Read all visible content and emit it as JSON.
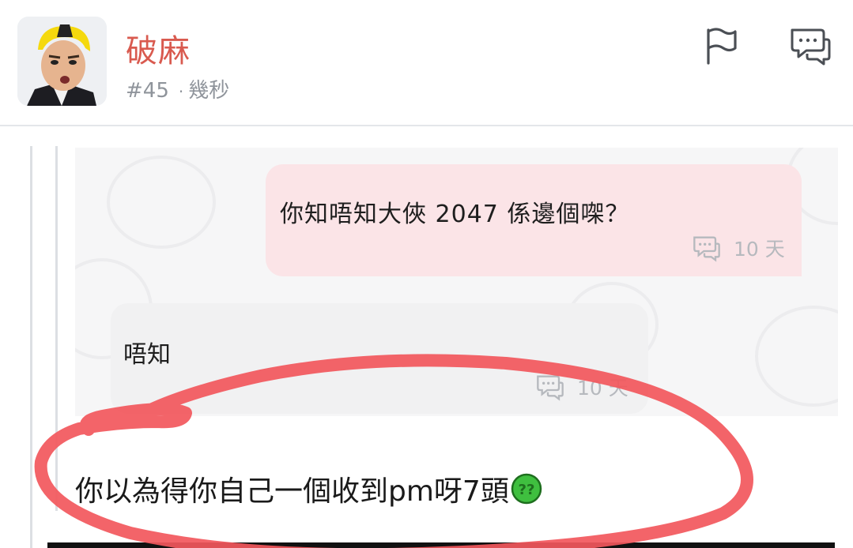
{
  "post": {
    "username": "破麻",
    "number": "#45",
    "separator": "·",
    "time": "幾秒",
    "avatar_icon": "cartoon-face-avatar"
  },
  "actions": {
    "report_icon": "flag-icon",
    "reply_icon": "chat-bubble-icon"
  },
  "chat": {
    "outgoing": {
      "text": "你知唔知大俠 2047 係邊個㗎？",
      "time": "10 天",
      "icon": "chat-bubble-icon"
    },
    "incoming": {
      "text": "唔知",
      "time": "10 天",
      "icon": "chat-bubble-icon"
    }
  },
  "reply_text": "你以為得你自己一個收到pm呀7頭",
  "reply_emoji": "green-question-face-emoji",
  "colors": {
    "username": "#d95a4f",
    "outgoing_bubble": "#fbe4e7",
    "incoming_bubble": "#f1f1f2",
    "annotation_red": "#f2575c"
  }
}
